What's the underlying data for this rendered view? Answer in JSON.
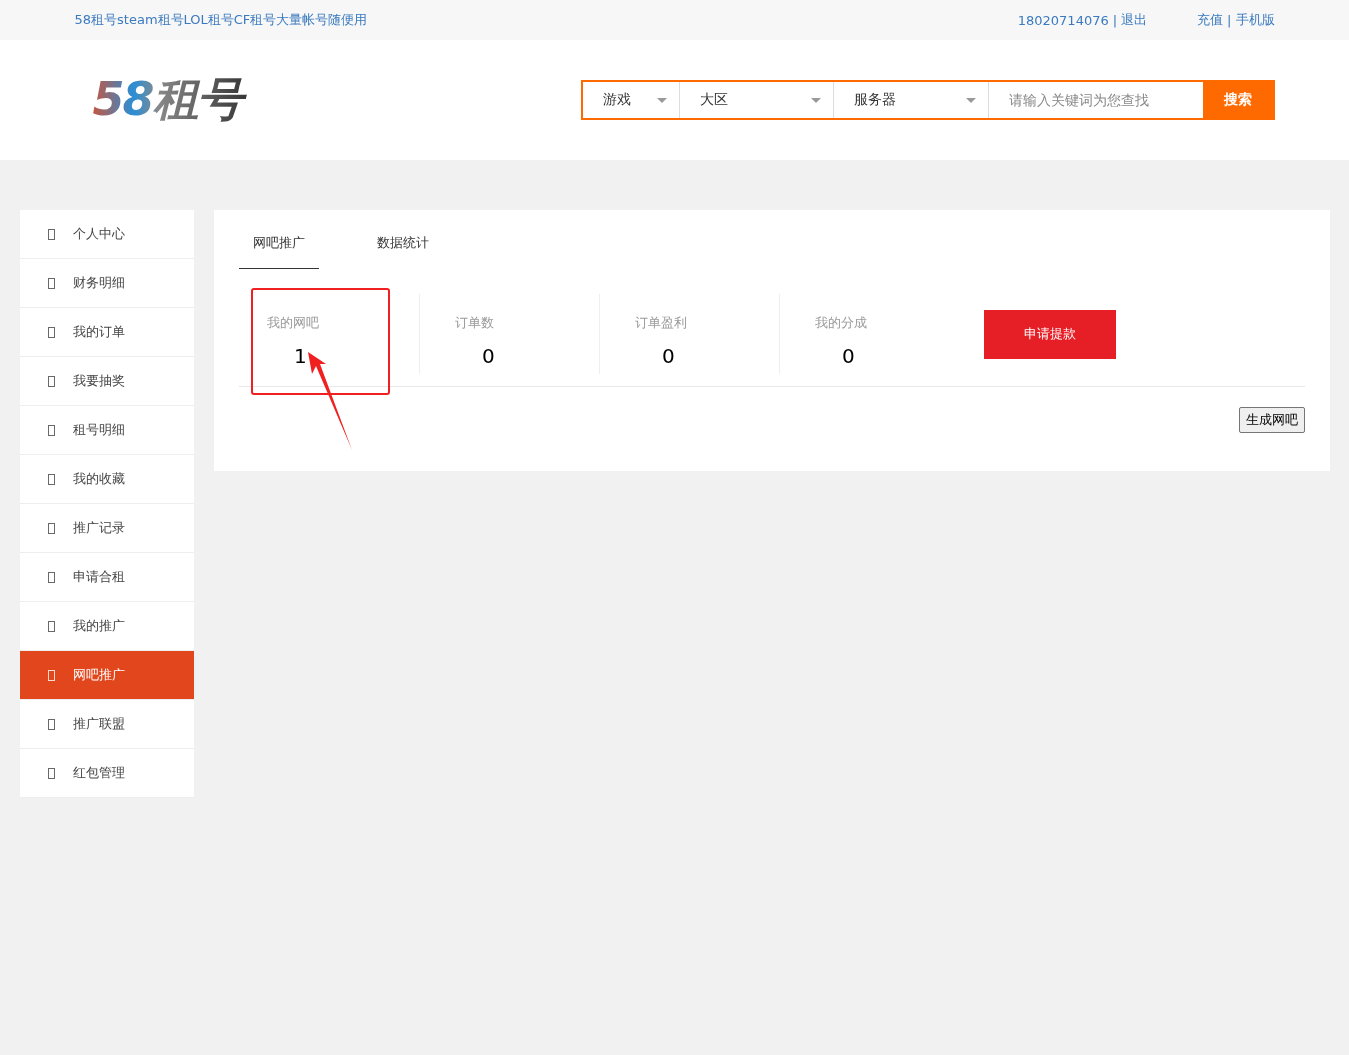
{
  "top_bar": {
    "slogan": "58租号steam租号LOL租号CF租号大量帐号随便用",
    "user_links": [
      {
        "kind": "link",
        "text": "18020714076"
      },
      {
        "kind": "separator",
        "text": "|"
      },
      {
        "kind": "link",
        "text": "退出"
      }
    ],
    "other_links": [
      {
        "kind": "link",
        "text": "充值"
      },
      {
        "kind": "separator",
        "text": "|"
      },
      {
        "kind": "link",
        "text": "手机版"
      }
    ]
  },
  "header": {
    "logo": "58租号",
    "search": {
      "selects": [
        {
          "value": "游戏"
        },
        {
          "value": "大区"
        },
        {
          "value": "服务器"
        }
      ],
      "placeholder": "请输入关键词为您查找",
      "button": "搜索"
    }
  },
  "sidebar": {
    "items": [
      {
        "label": "个人中心",
        "selected": false
      },
      {
        "label": "财务明细",
        "selected": false
      },
      {
        "label": "我的订单",
        "selected": false
      },
      {
        "label": "我要抽奖",
        "selected": false
      },
      {
        "label": "租号明细",
        "selected": false
      },
      {
        "label": "我的收藏",
        "selected": false
      },
      {
        "label": "推广记录",
        "selected": false
      },
      {
        "label": "申请合租",
        "selected": false
      },
      {
        "label": "我的推广",
        "selected": false
      },
      {
        "label": "网吧推广",
        "selected": true
      },
      {
        "label": "推广联盟",
        "selected": false
      },
      {
        "label": "红包管理",
        "selected": false
      }
    ]
  },
  "tabs": [
    {
      "label": "网吧推广",
      "selected": true
    },
    {
      "label": "数据统计",
      "selected": false
    }
  ],
  "stats": [
    {
      "label": "我的网吧",
      "value": "1",
      "highlighted": true
    },
    {
      "label": "订单数",
      "value": "0",
      "highlighted": false
    },
    {
      "label": "订单盈利",
      "value": "0",
      "highlighted": false
    },
    {
      "label": "我的分成",
      "value": "0",
      "highlighted": false
    }
  ],
  "withdraw_button": "申请提款",
  "generate_button": "生成网吧"
}
